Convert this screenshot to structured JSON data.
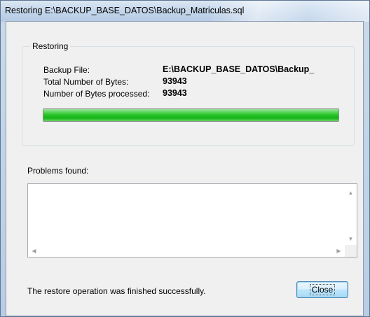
{
  "window": {
    "title": "Restoring E:\\BACKUP_BASE_DATOS\\Backup_Matriculas.sql"
  },
  "restoring_group": {
    "legend": "Restoring",
    "backup_file_label": "Backup File:",
    "backup_file_value": "E:\\BACKUP_BASE_DATOS\\Backup_",
    "total_bytes_label": "Total Number of Bytes:",
    "total_bytes_value": "93943",
    "processed_bytes_label": "Number of Bytes processed:",
    "processed_bytes_value": "93943",
    "progress_fraction": 1.0
  },
  "problems": {
    "label": "Problems found:",
    "content": ""
  },
  "status": {
    "message": "The restore operation was finished successfully."
  },
  "buttons": {
    "close_label": "Close"
  },
  "colors": {
    "progress_green": "#1fbf1f",
    "window_frame": "#b8cde4",
    "client_bg": "#f0f0f0"
  }
}
